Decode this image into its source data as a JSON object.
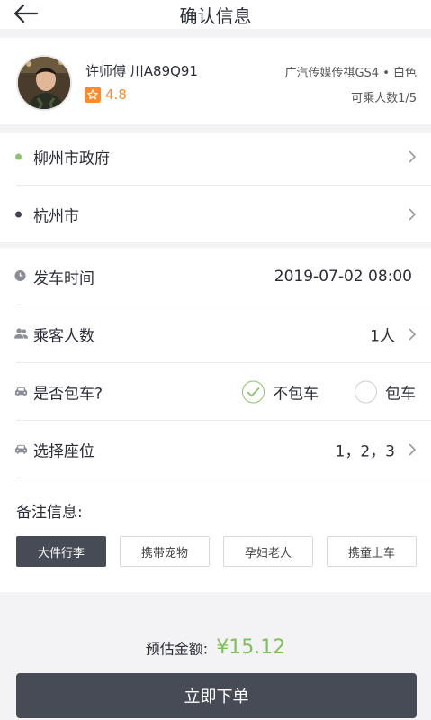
{
  "header": {
    "title": "确认信息"
  },
  "driver": {
    "name_plate": "许师傅  川A89Q91",
    "rating": "4.8",
    "car": "广汽传媒传祺GS4 • 白色",
    "seats": "可乘人数1/5"
  },
  "route": {
    "origin": "柳州市政府",
    "destination": "杭州市",
    "origin_color": "#8cc26a",
    "destination_color": "#3d4356"
  },
  "form": {
    "departure": {
      "label": "发车时间",
      "value": "2019-07-02 08:00"
    },
    "passengers": {
      "label": "乘客人数",
      "value": "1人"
    },
    "charter": {
      "label": "是否包车?",
      "options": [
        {
          "label": "不包车",
          "checked": true
        },
        {
          "label": "包车",
          "checked": false
        }
      ]
    },
    "seat": {
      "label": "选择座位",
      "value": "1，2，3"
    }
  },
  "remarks": {
    "title": "备注信息:",
    "tags": [
      {
        "label": "大件行李",
        "active": true
      },
      {
        "label": "携带宠物",
        "active": false
      },
      {
        "label": "孕妇老人",
        "active": false
      },
      {
        "label": "携童上车",
        "active": false
      }
    ]
  },
  "footer": {
    "estimate_label": "预估金额:",
    "estimate_price": "¥15.12",
    "submit_label": "立即下单"
  },
  "colors": {
    "accent_green": "#7fbf5a",
    "rating_orange": "#ff8a2a",
    "button_dark": "#474b56"
  }
}
